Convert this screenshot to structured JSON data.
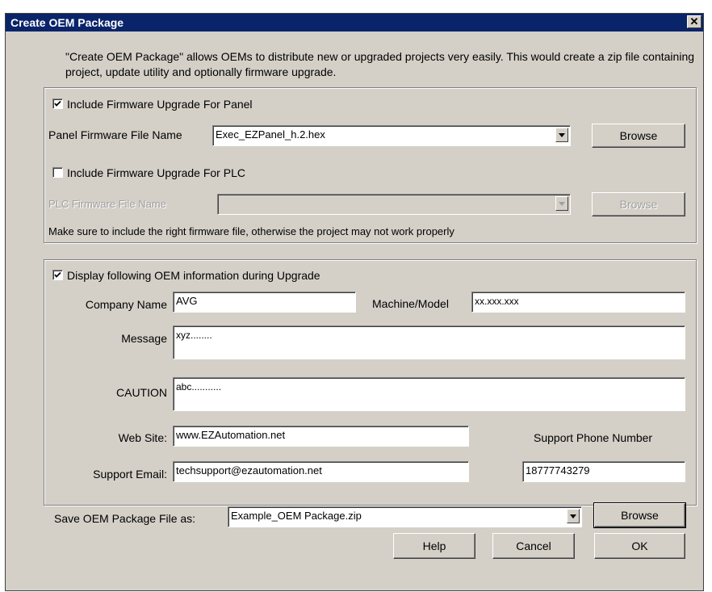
{
  "window": {
    "title": "Create OEM Package",
    "close_glyph": "✕"
  },
  "description": "\"Create OEM Package\" allows OEMs to distribute new or upgraded projects very easily. This would create a zip file containing project, update utility and optionally firmware upgrade.",
  "firmware": {
    "panel_checkbox_label": "Include Firmware Upgrade For Panel",
    "panel_checked": true,
    "panel_file_label": "Panel Firmware File Name",
    "panel_file_value": "Exec_EZPanel_h.2.hex",
    "panel_browse": "Browse",
    "plc_checkbox_label": "Include Firmware Upgrade For PLC",
    "plc_checked": false,
    "plc_file_label": "PLC Firmware File Name",
    "plc_file_value": "",
    "plc_browse": "Browse",
    "note": "Make sure to include the right firmware file, otherwise the project may not work properly"
  },
  "oem": {
    "checkbox_label": "Display following OEM information during Upgrade",
    "checked": true,
    "company_label": "Company Name",
    "company_value": "AVG",
    "model_label": "Machine/Model",
    "model_value": "xx.xxx.xxx",
    "message_label": "Message",
    "message_value": "xyz........",
    "caution_label": "CAUTION",
    "caution_value": "abc...........",
    "website_label": "Web Site:",
    "website_value": "www.EZAutomation.net",
    "phone_label": "Support Phone Number",
    "phone_value": "18777743279",
    "email_label": "Support Email:",
    "email_value": "techsupport@ezautomation.net"
  },
  "save": {
    "label": "Save OEM Package File as:",
    "value": "Example_OEM Package.zip",
    "browse": "Browse"
  },
  "buttons": {
    "help": "Help",
    "cancel": "Cancel",
    "ok": "OK"
  },
  "icons": {
    "checkmark": "checkmark-icon",
    "dropdown": "chevron-down-icon",
    "close": "close-icon"
  }
}
